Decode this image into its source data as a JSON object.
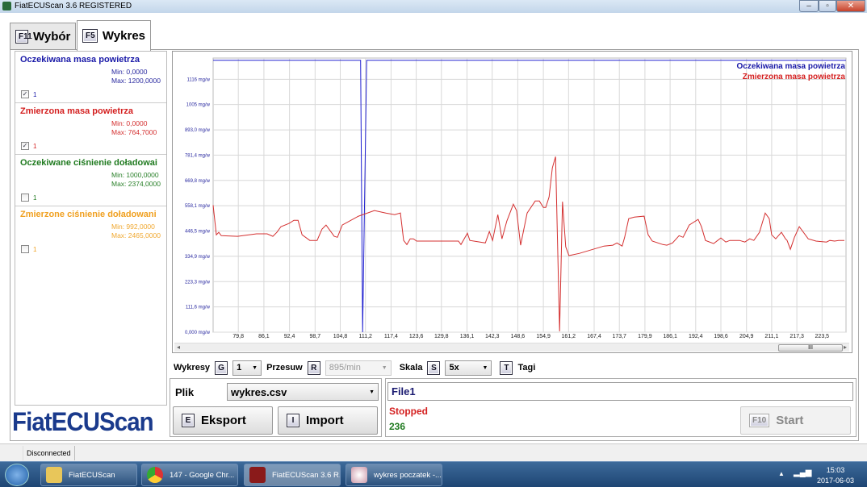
{
  "window": {
    "title": "FiatECUScan 3.6 REGISTERED",
    "controls": [
      "–",
      "▫",
      "✕"
    ]
  },
  "tabs": [
    {
      "key": "F11",
      "label": "Wybór"
    },
    {
      "key": "F5",
      "label": "Wykres"
    }
  ],
  "params": [
    {
      "name": "Oczekiwana masa powietrza",
      "min": "Min: 0,0000",
      "max": "Max: 1200,0000",
      "checked": true,
      "group": "1",
      "color": "#1a1aa8"
    },
    {
      "name": "Zmierzona masa powietrza",
      "min": "Min: 0,0000",
      "max": "Max: 764,7000",
      "checked": true,
      "group": "1",
      "color": "#d42020"
    },
    {
      "name": "Oczekiwane ciśnienie doładowai",
      "min": "Min: 1000,0000",
      "max": "Max: 2374,0000",
      "checked": false,
      "group": "1",
      "color": "#1f7a1f"
    },
    {
      "name": "Zmierzone ciśnienie doładowani",
      "min": "Min: 992,0000",
      "max": "Max: 2465,0000",
      "checked": false,
      "group": "1",
      "color": "#f0a020"
    }
  ],
  "chart_data": {
    "type": "line",
    "xlim": [
      73.6,
      229.4
    ],
    "ylim": [
      0,
      1210
    ],
    "grid": true,
    "legend_placement": "top-right",
    "x_ticks": [
      "79,8",
      "86,1",
      "92,4",
      "98,7",
      "104,8",
      "111,2",
      "117,4",
      "123,6",
      "129,8",
      "136,1",
      "142,3",
      "148,6",
      "154,9",
      "161,2",
      "167,4",
      "173,7",
      "179,9",
      "186,1",
      "192,4",
      "198,6",
      "204,9",
      "211,1",
      "217,3",
      "223,5"
    ],
    "x_tick_values": [
      79.8,
      86.1,
      92.4,
      98.7,
      104.9,
      111.1,
      117.4,
      123.6,
      129.8,
      136.1,
      142.3,
      148.6,
      154.9,
      161.1,
      167.4,
      173.6,
      179.9,
      186.1,
      192.4,
      198.6,
      204.9,
      211.1,
      217.3,
      223.5
    ],
    "y_ticks": [
      "0,000 mg/w",
      "111,6 mg/w",
      "223,3 mg/w",
      "334,9 mg/w",
      "446,5 mg/w",
      "558,1 mg/w",
      "669,8 mg/w",
      "781,4 mg/w",
      "893,0 mg/w",
      "1005 mg/w",
      "1116 mg/w"
    ],
    "y_tick_values": [
      0,
      111.6,
      223.3,
      334.9,
      446.5,
      558.1,
      669.8,
      781.4,
      893.0,
      1005,
      1116
    ],
    "series": [
      {
        "name": "Oczekiwana masa powietrza",
        "color": "#2020d0",
        "points": [
          [
            73.6,
            1200
          ],
          [
            109.9,
            1200
          ],
          [
            110.4,
            0
          ],
          [
            111.4,
            1200
          ],
          [
            229.4,
            1200
          ]
        ]
      },
      {
        "name": "Zmierzona masa powietrza",
        "color": "#d43030",
        "points": [
          [
            73.6,
            561
          ],
          [
            74.4,
            430
          ],
          [
            75.0,
            441
          ],
          [
            75.6,
            426
          ],
          [
            79.6,
            423
          ],
          [
            84.3,
            434
          ],
          [
            86.9,
            434
          ],
          [
            88.3,
            423
          ],
          [
            89.3,
            441
          ],
          [
            90.3,
            466
          ],
          [
            92.3,
            480
          ],
          [
            93.5,
            494
          ],
          [
            94.5,
            494
          ],
          [
            95.5,
            430
          ],
          [
            97.4,
            405
          ],
          [
            99.2,
            405
          ],
          [
            100.4,
            455
          ],
          [
            101.4,
            473
          ],
          [
            103.4,
            423
          ],
          [
            104.2,
            419
          ],
          [
            105.4,
            473
          ],
          [
            109.4,
            512
          ],
          [
            113.3,
            537
          ],
          [
            116.1,
            526
          ],
          [
            118.3,
            519
          ],
          [
            119.7,
            526
          ],
          [
            120.5,
            405
          ],
          [
            121.3,
            387
          ],
          [
            122.1,
            412
          ],
          [
            122.9,
            412
          ],
          [
            123.7,
            402
          ],
          [
            134.0,
            402
          ],
          [
            134.6,
            387
          ],
          [
            136.2,
            437
          ],
          [
            136.8,
            405
          ],
          [
            140.6,
            394
          ],
          [
            141.6,
            444
          ],
          [
            142.4,
            405
          ],
          [
            143.7,
            519
          ],
          [
            144.7,
            412
          ],
          [
            145.9,
            490
          ],
          [
            147.5,
            565
          ],
          [
            148.3,
            537
          ],
          [
            149.3,
            384
          ],
          [
            150.9,
            526
          ],
          [
            152.9,
            579
          ],
          [
            153.9,
            579
          ],
          [
            154.9,
            551
          ],
          [
            155.5,
            551
          ],
          [
            156.3,
            597
          ],
          [
            157.1,
            725
          ],
          [
            157.9,
            775
          ],
          [
            158.9,
            4
          ],
          [
            159.6,
            576
          ],
          [
            160.4,
            377
          ],
          [
            161.2,
            338
          ],
          [
            163.8,
            348
          ],
          [
            169.8,
            380
          ],
          [
            172.0,
            384
          ],
          [
            173.0,
            394
          ],
          [
            174.3,
            380
          ],
          [
            174.9,
            419
          ],
          [
            175.9,
            501
          ],
          [
            177.3,
            508
          ],
          [
            179.7,
            512
          ],
          [
            180.7,
            430
          ],
          [
            181.7,
            402
          ],
          [
            184.3,
            387
          ],
          [
            185.3,
            384
          ],
          [
            186.7,
            394
          ],
          [
            188.3,
            426
          ],
          [
            189.3,
            419
          ],
          [
            190.8,
            473
          ],
          [
            193.0,
            498
          ],
          [
            193.8,
            466
          ],
          [
            194.8,
            405
          ],
          [
            196.8,
            391
          ],
          [
            198.6,
            416
          ],
          [
            199.8,
            398
          ],
          [
            200.8,
            405
          ],
          [
            203.2,
            405
          ],
          [
            204.5,
            398
          ],
          [
            205.7,
            412
          ],
          [
            206.7,
            405
          ],
          [
            208.1,
            441
          ],
          [
            209.5,
            526
          ],
          [
            210.5,
            501
          ],
          [
            211.1,
            430
          ],
          [
            212.1,
            412
          ],
          [
            213.5,
            441
          ],
          [
            214.5,
            412
          ],
          [
            214.9,
            405
          ],
          [
            215.7,
            366
          ],
          [
            216.7,
            419
          ],
          [
            217.9,
            466
          ],
          [
            220.1,
            412
          ],
          [
            222.0,
            402
          ],
          [
            224.6,
            398
          ],
          [
            225.4,
            405
          ],
          [
            226.6,
            402
          ],
          [
            227.6,
            405
          ],
          [
            229.0,
            405
          ]
        ]
      }
    ]
  },
  "scrollbar": {
    "thumb_grip": "III",
    "left_arrow": "◂",
    "right_arrow": "▸"
  },
  "controls": {
    "wykresy_label": "Wykresy",
    "wykresy_key": "G",
    "wykresy_value": "1",
    "przesuw_label": "Przesuw",
    "przesuw_key": "R",
    "przesuw_value": "895/min",
    "skala_label": "Skala",
    "skala_key": "S",
    "skala_value": "5x",
    "tagi_key": "T",
    "tagi_label": "Tagi"
  },
  "file": {
    "label": "Plik",
    "value": "wykres.csv",
    "export_key": "E",
    "export_label": "Eksport",
    "import_key": "I",
    "import_label": "Import"
  },
  "run": {
    "file_name": "File1",
    "status": "Stopped",
    "count": "236",
    "start_key": "F10",
    "start_label": "Start"
  },
  "logo": "FiatECUScan",
  "statusbar": {
    "connection": "Disconnected"
  },
  "taskbar": {
    "items": [
      "FiatECUScan",
      "147 - Google Chr...",
      "FiatECUScan 3.6 R...",
      "wykres poczatek -..."
    ],
    "time": "15:03",
    "date": "2017-06-03"
  }
}
